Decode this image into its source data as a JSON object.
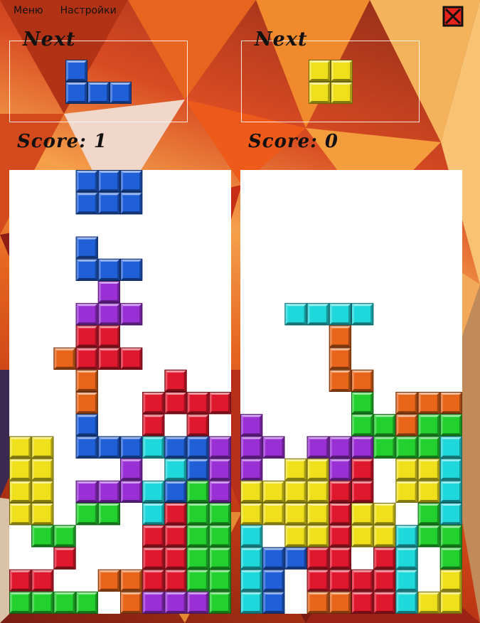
{
  "menu": {
    "items": [
      "Меню",
      "Настройки"
    ]
  },
  "close_button": {
    "icon": "close-x-icon",
    "color": "#e8231c"
  },
  "players": [
    {
      "next_label": "Next",
      "score_label": "Score: 1",
      "next_piece": {
        "type": "J",
        "color": "blue",
        "cells": [
          [
            0,
            0
          ],
          [
            0,
            1
          ],
          [
            1,
            1
          ],
          [
            2,
            1
          ]
        ]
      },
      "board_rows": [
        "...BBB....",
        "...BBB....",
        "..........",
        "...B......",
        "...BBB....",
        "....P.....",
        "...PPP....",
        "...RR.....",
        "..ORRR....",
        "...O...R..",
        "...O..RRRR",
        "...B..R.R.",
        "YY.BBBCBBP",
        "YY...P.CBPP",
        "YY.PPPCBGP",
        "YY.GG.CRGG",
        ".GG...RRGG",
        "..R...RRGG",
        "RR..OORRGG",
        "GGGG.OPPPG"
      ]
    },
    {
      "next_label": "Next",
      "score_label": "Score: 0",
      "next_piece": {
        "type": "O",
        "color": "yellow",
        "cells": [
          [
            0,
            0
          ],
          [
            1,
            0
          ],
          [
            0,
            1
          ],
          [
            1,
            1
          ]
        ]
      },
      "board_rows": [
        "..........",
        "..........",
        "..........",
        "..........",
        "..........",
        "..........",
        "..CCCC....",
        "....O.....",
        "....O.....",
        "....OO....",
        ".....G.OOO",
        "P....GGOGG",
        "PP.PPPGGGC",
        "P.YYPR.YYC",
        "YYYYRR.YYC",
        "YYYYRYY.GC",
        "C.YYRYYCGG",
        "CBBRR.RC.G",
        "CB.RRRRC.YY",
        "CB.OORRCYY"
      ]
    }
  ],
  "palette": {
    "B": "#1f5fd8",
    "P": "#9b2fd6",
    "R": "#e0182e",
    "O": "#e8651a",
    "Y": "#f0e01c",
    "G": "#22d12e",
    "C": "#1fd8dc"
  }
}
